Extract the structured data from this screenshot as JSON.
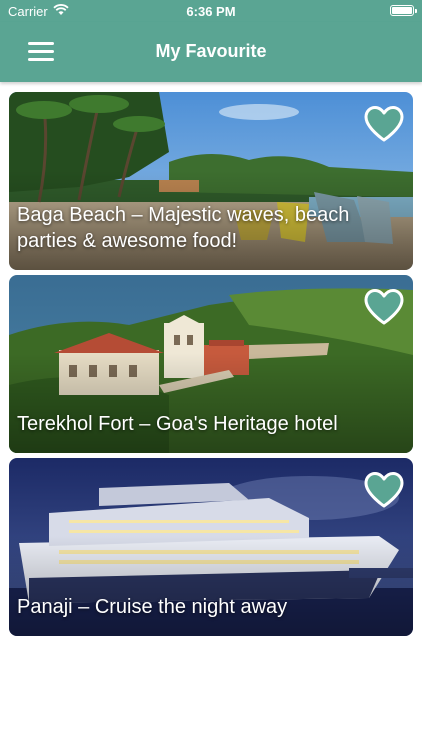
{
  "status_bar": {
    "carrier": "Carrier",
    "time": "6:36 PM",
    "wifi_icon": "wifi-icon",
    "battery_icon": "battery-icon"
  },
  "nav": {
    "title": "My Favourite",
    "menu_icon": "hamburger-menu-icon"
  },
  "colors": {
    "brand": "#5aa593",
    "heart_fill": "#5aa593",
    "heart_stroke": "#ffffff",
    "text_on_image": "#ffffff"
  },
  "favourites": [
    {
      "title": "Baga Beach – Majestic waves, beach parties & awesome food!",
      "image": "beach-with-palm-trees-and-boats",
      "favourited": true
    },
    {
      "title": "Terekhol Fort – Goa's Heritage hotel",
      "image": "fort-on-green-hill-by-sea",
      "favourited": true
    },
    {
      "title": "Panaji – Cruise the night away",
      "image": "cruise-ship-at-night",
      "favourited": true
    }
  ]
}
